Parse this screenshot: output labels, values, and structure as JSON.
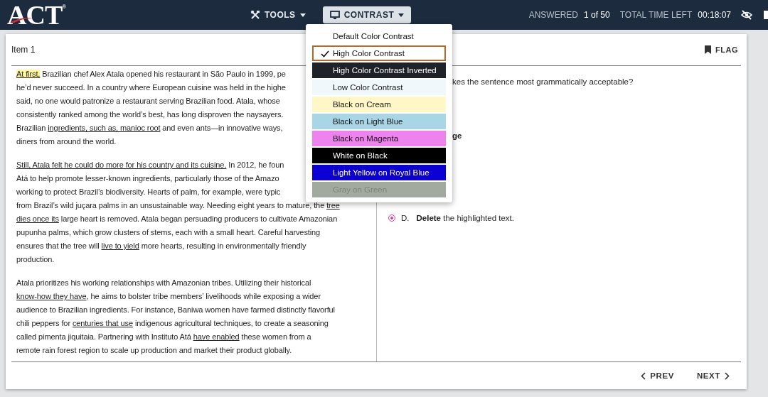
{
  "header": {
    "logo": "ACT",
    "logo_mark": "®",
    "tools": {
      "label": "TOOLS"
    },
    "contrast": {
      "label": "CONTRAST",
      "selected": true
    },
    "answered_label": "ANSWERED",
    "answered_value": "1 of 50",
    "time_label": "TOTAL TIME LEFT",
    "time_value": "00:18:07"
  },
  "contrast_menu": [
    {
      "label": "Default Color Contrast",
      "selected": false,
      "color": "#ffffff"
    },
    {
      "label": "High Color Contrast",
      "selected": true,
      "color": "#ffffff"
    },
    {
      "label": "High Color Contrast Inverted",
      "selected": false,
      "color": "#1f2329"
    },
    {
      "label": "Low Color Contrast",
      "selected": false,
      "color": "#f1f8fc"
    },
    {
      "label": "Black on Cream",
      "selected": false,
      "color": "#fff8c6"
    },
    {
      "label": "Black on Light Blue",
      "selected": false,
      "color": "#a9d6e6"
    },
    {
      "label": "Black on Magenta",
      "selected": false,
      "color": "#ee82ee"
    },
    {
      "label": "White on Black",
      "selected": false,
      "color": "#000000"
    },
    {
      "label": "Light Yellow on Royal Blue",
      "selected": false,
      "color": "#0a00d6"
    },
    {
      "label": "Gray on Green",
      "selected": false,
      "color": "#a2aaa0"
    }
  ],
  "item": {
    "title": "Item 1",
    "flag": {
      "label": "FLAG",
      "checked": false
    }
  },
  "passage": [
    [
      [
        {
          "text": "At first,",
          "underlined": true,
          "highlighted": true
        },
        {
          "text": " Brazilian chef Alex Atala opened his restaurant in São Paulo in 1999, pe"
        }
      ],
      [
        {
          "text": "he’d never succeed. In a country where European cuisine was held in the highe"
        }
      ],
      [
        {
          "text": "said, no one would patronize a restaurant serving Brazilian food. Atala, whose"
        }
      ],
      [
        {
          "text": "consistently ranked among the world’s best, has long disproven the naysayers."
        }
      ],
      [
        {
          "text": "Brazilian "
        },
        {
          "text": "ingredients, such as, manioc root",
          "underlined": true
        },
        {
          "text": " and even ants—in innovative ways,"
        }
      ],
      [
        {
          "text": "diners from around the world."
        }
      ]
    ],
    [
      [
        {
          "text": "Still, Atala felt he could do more for his country and its cuisine.",
          "underlined": true
        },
        {
          "text": " In 2012, he foun"
        }
      ],
      [
        {
          "text": "Atá to help promote lesser-known ingredients, particularly those of the Amazo"
        }
      ],
      [
        {
          "text": "working to protect Brazil’s biodiversity. Hearts of palm, for example, were typic"
        }
      ],
      [
        {
          "text": "from Brazil’s wild juçara palms in an unsustainable way. Needing eight years to mature, the "
        },
        {
          "text": "tree",
          "underlined": true
        }
      ],
      [
        {
          "text": "dies once its",
          "underlined": true
        },
        {
          "text": " large heart is removed. Atala began persuading producers to cultivate Amazonian"
        }
      ],
      [
        {
          "text": "pupunha palms, which grow clusters of stems, each with a small heart. Careful harvesting"
        }
      ],
      [
        {
          "text": "ensures that the tree will "
        },
        {
          "text": "live to yield",
          "underlined": true
        },
        {
          "text": " more hearts, resulting in environmentally friendly"
        }
      ],
      [
        {
          "text": "production."
        }
      ]
    ],
    [
      [
        {
          "text": "Atala prioritizes his working relationships with Amazonian tribes. Utilizing their historical"
        }
      ],
      [
        {
          "text": "know-how they have",
          "underlined": true
        },
        {
          "text": ", he aims to bolster tribe members’ livelihoods while exposing a wider"
        }
      ],
      [
        {
          "text": "audience to Brazilian ingredients. For instance, Baniwa women have farmed distinctly flavorful"
        }
      ],
      [
        {
          "text": "chili peppers for "
        },
        {
          "text": "centuries that use",
          "underlined": true
        },
        {
          "text": " indigenous agricultural techniques, to create a seasoning"
        }
      ],
      [
        {
          "text": "called pimenta jiquitaia. Partnering with Instituto Atá "
        },
        {
          "text": "have enabled",
          "underlined": true
        },
        {
          "text": " these women from a"
        }
      ],
      [
        {
          "text": "remote rain forest region to scale up production and market their product globally."
        }
      ]
    ]
  ],
  "question": {
    "text": "kes the sentence most grammatically acceptable?",
    "option_fragment": "ge",
    "options": [
      {
        "letter": "D.",
        "text": "**Delete** the highlighted text.",
        "selected": true
      }
    ]
  },
  "nav": {
    "prev": "PREV",
    "next": "NEXT"
  }
}
